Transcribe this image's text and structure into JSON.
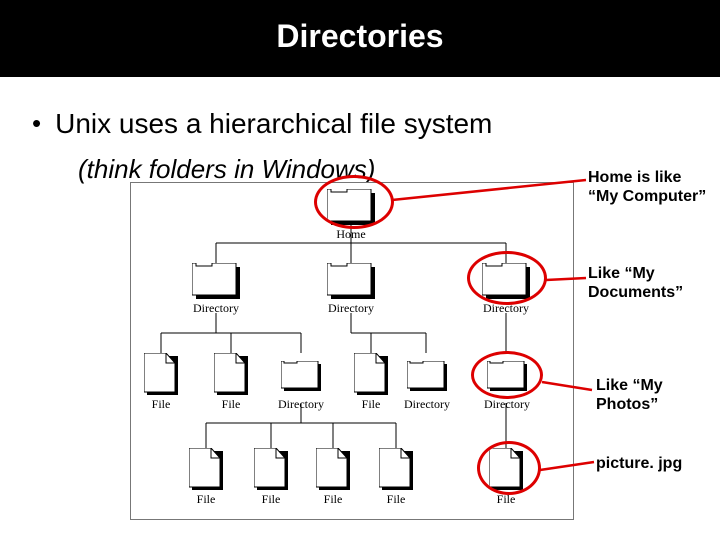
{
  "title": "Directories",
  "bullet": "Unix uses a hierarchical file system",
  "subtext": "(think folders in Windows)",
  "labels": {
    "home": "Home",
    "directory": "Directory",
    "file": "File"
  },
  "annotations": {
    "home": "Home is like “My Computer”",
    "docs": "Like “My Documents”",
    "photos": "Like “My Photos”",
    "picture": "picture. jpg"
  }
}
